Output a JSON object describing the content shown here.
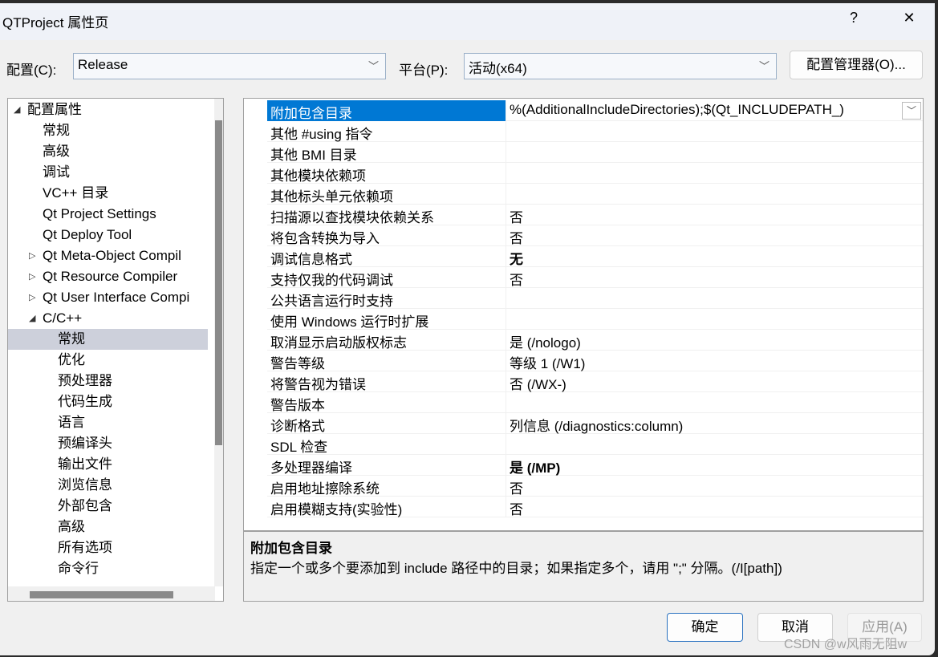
{
  "window": {
    "title": "QTProject 属性页",
    "help": "?",
    "close": "✕"
  },
  "config": {
    "label": "配置(C):",
    "value": "Release",
    "platform_label": "平台(P):",
    "platform_value": "活动(x64)",
    "manager_button": "配置管理器(O)..."
  },
  "tree": [
    {
      "label": "配置属性",
      "level": 0,
      "expander": "◢"
    },
    {
      "label": "常规",
      "level": 1
    },
    {
      "label": "高级",
      "level": 1
    },
    {
      "label": "调试",
      "level": 1
    },
    {
      "label": "VC++ 目录",
      "level": 1
    },
    {
      "label": "Qt Project Settings",
      "level": 1
    },
    {
      "label": "Qt Deploy Tool",
      "level": 1
    },
    {
      "label": "Qt Meta-Object Compil",
      "level": 1,
      "expander": "▷"
    },
    {
      "label": "Qt Resource Compiler",
      "level": 1,
      "expander": "▷"
    },
    {
      "label": "Qt User Interface Compi",
      "level": 1,
      "expander": "▷"
    },
    {
      "label": "C/C++",
      "level": 1,
      "expander": "◢"
    },
    {
      "label": "常规",
      "level": 2,
      "selected": true
    },
    {
      "label": "优化",
      "level": 2
    },
    {
      "label": "预处理器",
      "level": 2
    },
    {
      "label": "代码生成",
      "level": 2
    },
    {
      "label": "语言",
      "level": 2
    },
    {
      "label": "预编译头",
      "level": 2
    },
    {
      "label": "输出文件",
      "level": 2
    },
    {
      "label": "浏览信息",
      "level": 2
    },
    {
      "label": "外部包含",
      "level": 2
    },
    {
      "label": "高级",
      "level": 2
    },
    {
      "label": "所有选项",
      "level": 2
    },
    {
      "label": "命令行",
      "level": 2
    }
  ],
  "properties": [
    {
      "name": "附加包含目录",
      "value": "%(AdditionalIncludeDirectories);$(Qt_INCLUDEPATH_)",
      "selected": true
    },
    {
      "name": "其他 #using 指令",
      "value": ""
    },
    {
      "name": "其他 BMI 目录",
      "value": ""
    },
    {
      "name": "其他模块依赖项",
      "value": ""
    },
    {
      "name": "其他标头单元依赖项",
      "value": ""
    },
    {
      "name": "扫描源以查找模块依赖关系",
      "value": "否"
    },
    {
      "name": "将包含转换为导入",
      "value": "否"
    },
    {
      "name": "调试信息格式",
      "value": "无",
      "bold": true
    },
    {
      "name": "支持仅我的代码调试",
      "value": "否"
    },
    {
      "name": "公共语言运行时支持",
      "value": ""
    },
    {
      "name": "使用 Windows 运行时扩展",
      "value": ""
    },
    {
      "name": "取消显示启动版权标志",
      "value": "是 (/nologo)"
    },
    {
      "name": "警告等级",
      "value": "等级 1 (/W1)"
    },
    {
      "name": "将警告视为错误",
      "value": "否 (/WX-)"
    },
    {
      "name": "警告版本",
      "value": ""
    },
    {
      "name": "诊断格式",
      "value": "列信息 (/diagnostics:column)"
    },
    {
      "name": "SDL 检查",
      "value": ""
    },
    {
      "name": "多处理器编译",
      "value": "是 (/MP)",
      "bold": true
    },
    {
      "name": "启用地址擦除系统",
      "value": "否"
    },
    {
      "name": "启用模糊支持(实验性)",
      "value": "否"
    }
  ],
  "description": {
    "title": "附加包含目录",
    "text": "指定一个或多个要添加到 include 路径中的目录；如果指定多个，请用 \";\" 分隔。(/I[path])"
  },
  "buttons": {
    "ok": "确定",
    "cancel": "取消",
    "apply": "应用(A)"
  },
  "watermark": "CSDN @w风雨无阻w",
  "colors": {
    "selection": "#0078d4",
    "tree_selection": "#cdd0db"
  }
}
